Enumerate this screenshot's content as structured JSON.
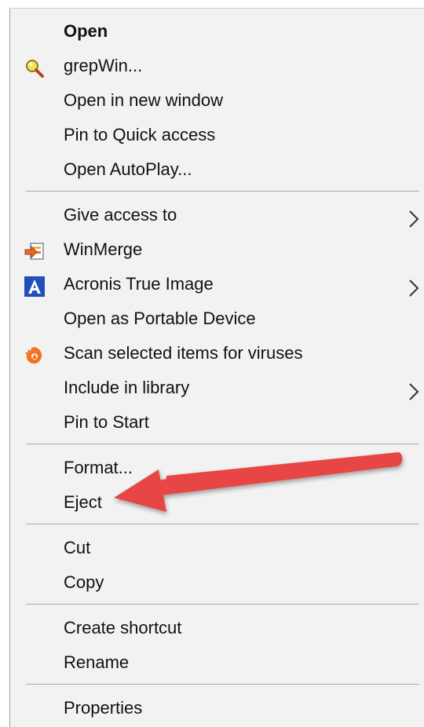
{
  "menu": {
    "items": [
      {
        "label": "Open",
        "icon": "",
        "submenu": false,
        "bold": true
      },
      {
        "label": "grepWin...",
        "icon": "grepwin-icon",
        "submenu": false
      },
      {
        "label": "Open in new window",
        "icon": "",
        "submenu": false
      },
      {
        "label": "Pin to Quick access",
        "icon": "",
        "submenu": false
      },
      {
        "label": "Open AutoPlay...",
        "icon": "",
        "submenu": false
      },
      {
        "label": "Give access to",
        "icon": "",
        "submenu": true
      },
      {
        "label": "WinMerge",
        "icon": "winmerge-icon",
        "submenu": false
      },
      {
        "label": "Acronis True Image",
        "icon": "acronis-icon",
        "submenu": true
      },
      {
        "label": "Open as Portable Device",
        "icon": "",
        "submenu": false
      },
      {
        "label": "Scan selected items for viruses",
        "icon": "avast-icon",
        "submenu": false
      },
      {
        "label": "Include in library",
        "icon": "",
        "submenu": true
      },
      {
        "label": "Pin to Start",
        "icon": "",
        "submenu": false
      },
      {
        "label": "Format...",
        "icon": "",
        "submenu": false
      },
      {
        "label": "Eject",
        "icon": "",
        "submenu": false
      },
      {
        "label": "Cut",
        "icon": "",
        "submenu": false
      },
      {
        "label": "Copy",
        "icon": "",
        "submenu": false
      },
      {
        "label": "Create shortcut",
        "icon": "",
        "submenu": false
      },
      {
        "label": "Rename",
        "icon": "",
        "submenu": false
      },
      {
        "label": "Properties",
        "icon": "",
        "submenu": false
      }
    ]
  },
  "annotation": {
    "pointer_target": "Eject",
    "color": "#e84545"
  },
  "colors": {
    "menu_bg": "#f2f2f2",
    "separator": "#a9a9a9",
    "text": "#111111"
  }
}
